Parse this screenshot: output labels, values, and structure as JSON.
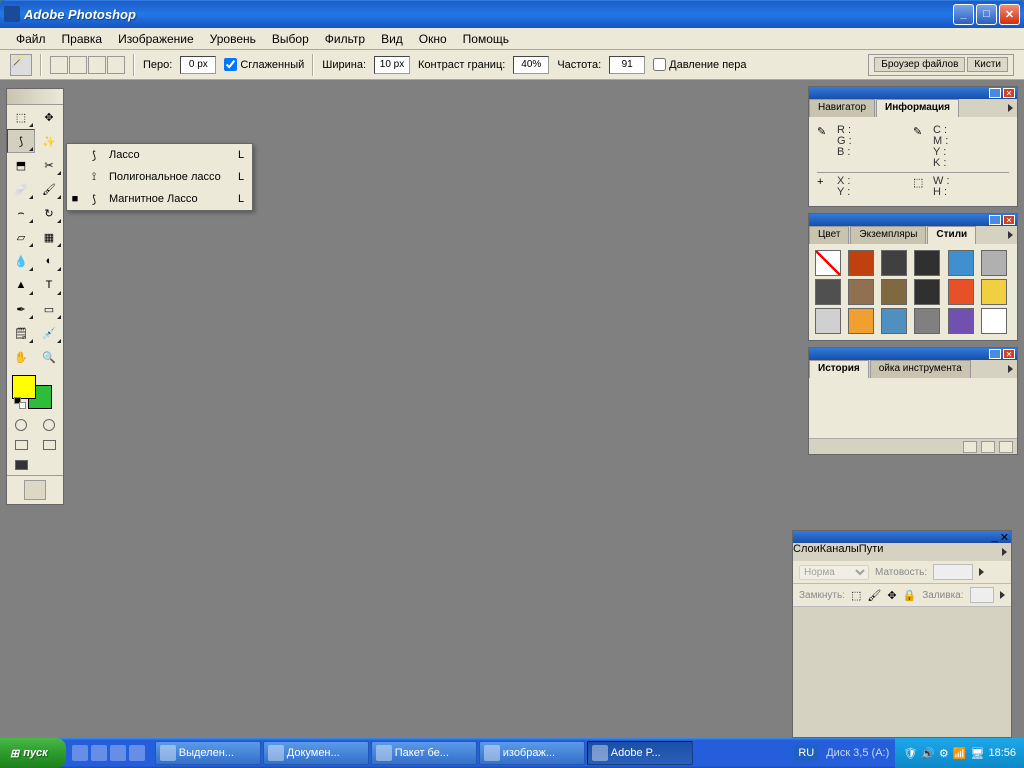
{
  "window": {
    "title": "Adobe Photoshop"
  },
  "menu": [
    "Файл",
    "Правка",
    "Изображение",
    "Уровень",
    "Выбор",
    "Фильтр",
    "Вид",
    "Окно",
    "Помощь"
  ],
  "options": {
    "feather_label": "Перо:",
    "feather_value": "0 px",
    "antialias": "Сглаженный",
    "width_label": "Ширина:",
    "width_value": "10 px",
    "contrast_label": "Контраст границ:",
    "contrast_value": "40%",
    "frequency_label": "Частота:",
    "frequency_value": "91",
    "pressure": "Давление пера",
    "well_tabs": [
      "Броузер файлов",
      "Кисти"
    ]
  },
  "flyout": [
    {
      "sel": "",
      "label": "Лассо",
      "key": "L"
    },
    {
      "sel": "",
      "label": "Полигональное лассо",
      "key": "L"
    },
    {
      "sel": "■",
      "label": "Магнитное Лассо",
      "key": "L"
    }
  ],
  "panels": {
    "nav_info": {
      "tabs": [
        "Навигатор",
        "Информация"
      ],
      "active": 1,
      "rgb": [
        "R :",
        "G :",
        "B :"
      ],
      "cmyk": [
        "C :",
        "M :",
        "Y :",
        "K :"
      ],
      "xy": [
        "X :",
        "Y :"
      ],
      "wh": [
        "W :",
        "H :"
      ]
    },
    "color": {
      "tabs": [
        "Цвет",
        "Экземпляры",
        "Стили"
      ],
      "active": 2
    },
    "history": {
      "tabs": [
        "История",
        "ойка инструмента"
      ],
      "active": 0
    },
    "layers": {
      "tabs": [
        "Слои",
        "Каналы",
        "Пути"
      ],
      "active": 0,
      "blend": "Норма",
      "opacity_label": "Матовость:",
      "lock_label": "Замкнуть:",
      "fill_label": "Заливка:"
    }
  },
  "style_colors": [
    "none",
    "#c04010",
    "#404040",
    "#303030",
    "#4090d0",
    "#b0b0b0",
    "#505050",
    "#907050",
    "#806840",
    "#303030",
    "#e85028",
    "#f0d040",
    "#d0d0d0",
    "#f0a030",
    "#5090c0",
    "#808080",
    "#7050b0",
    "#ffffff"
  ],
  "taskbar": {
    "start": "пуск",
    "tasks": [
      {
        "label": "Выделен...",
        "active": false
      },
      {
        "label": "Докумен...",
        "active": false
      },
      {
        "label": "Пакет бе...",
        "active": false
      },
      {
        "label": "изображ...",
        "active": false
      },
      {
        "label": "Adobe P...",
        "active": true
      }
    ],
    "lang": "RU",
    "disk": "Диск 3,5 (A:)",
    "time": "18:56"
  }
}
